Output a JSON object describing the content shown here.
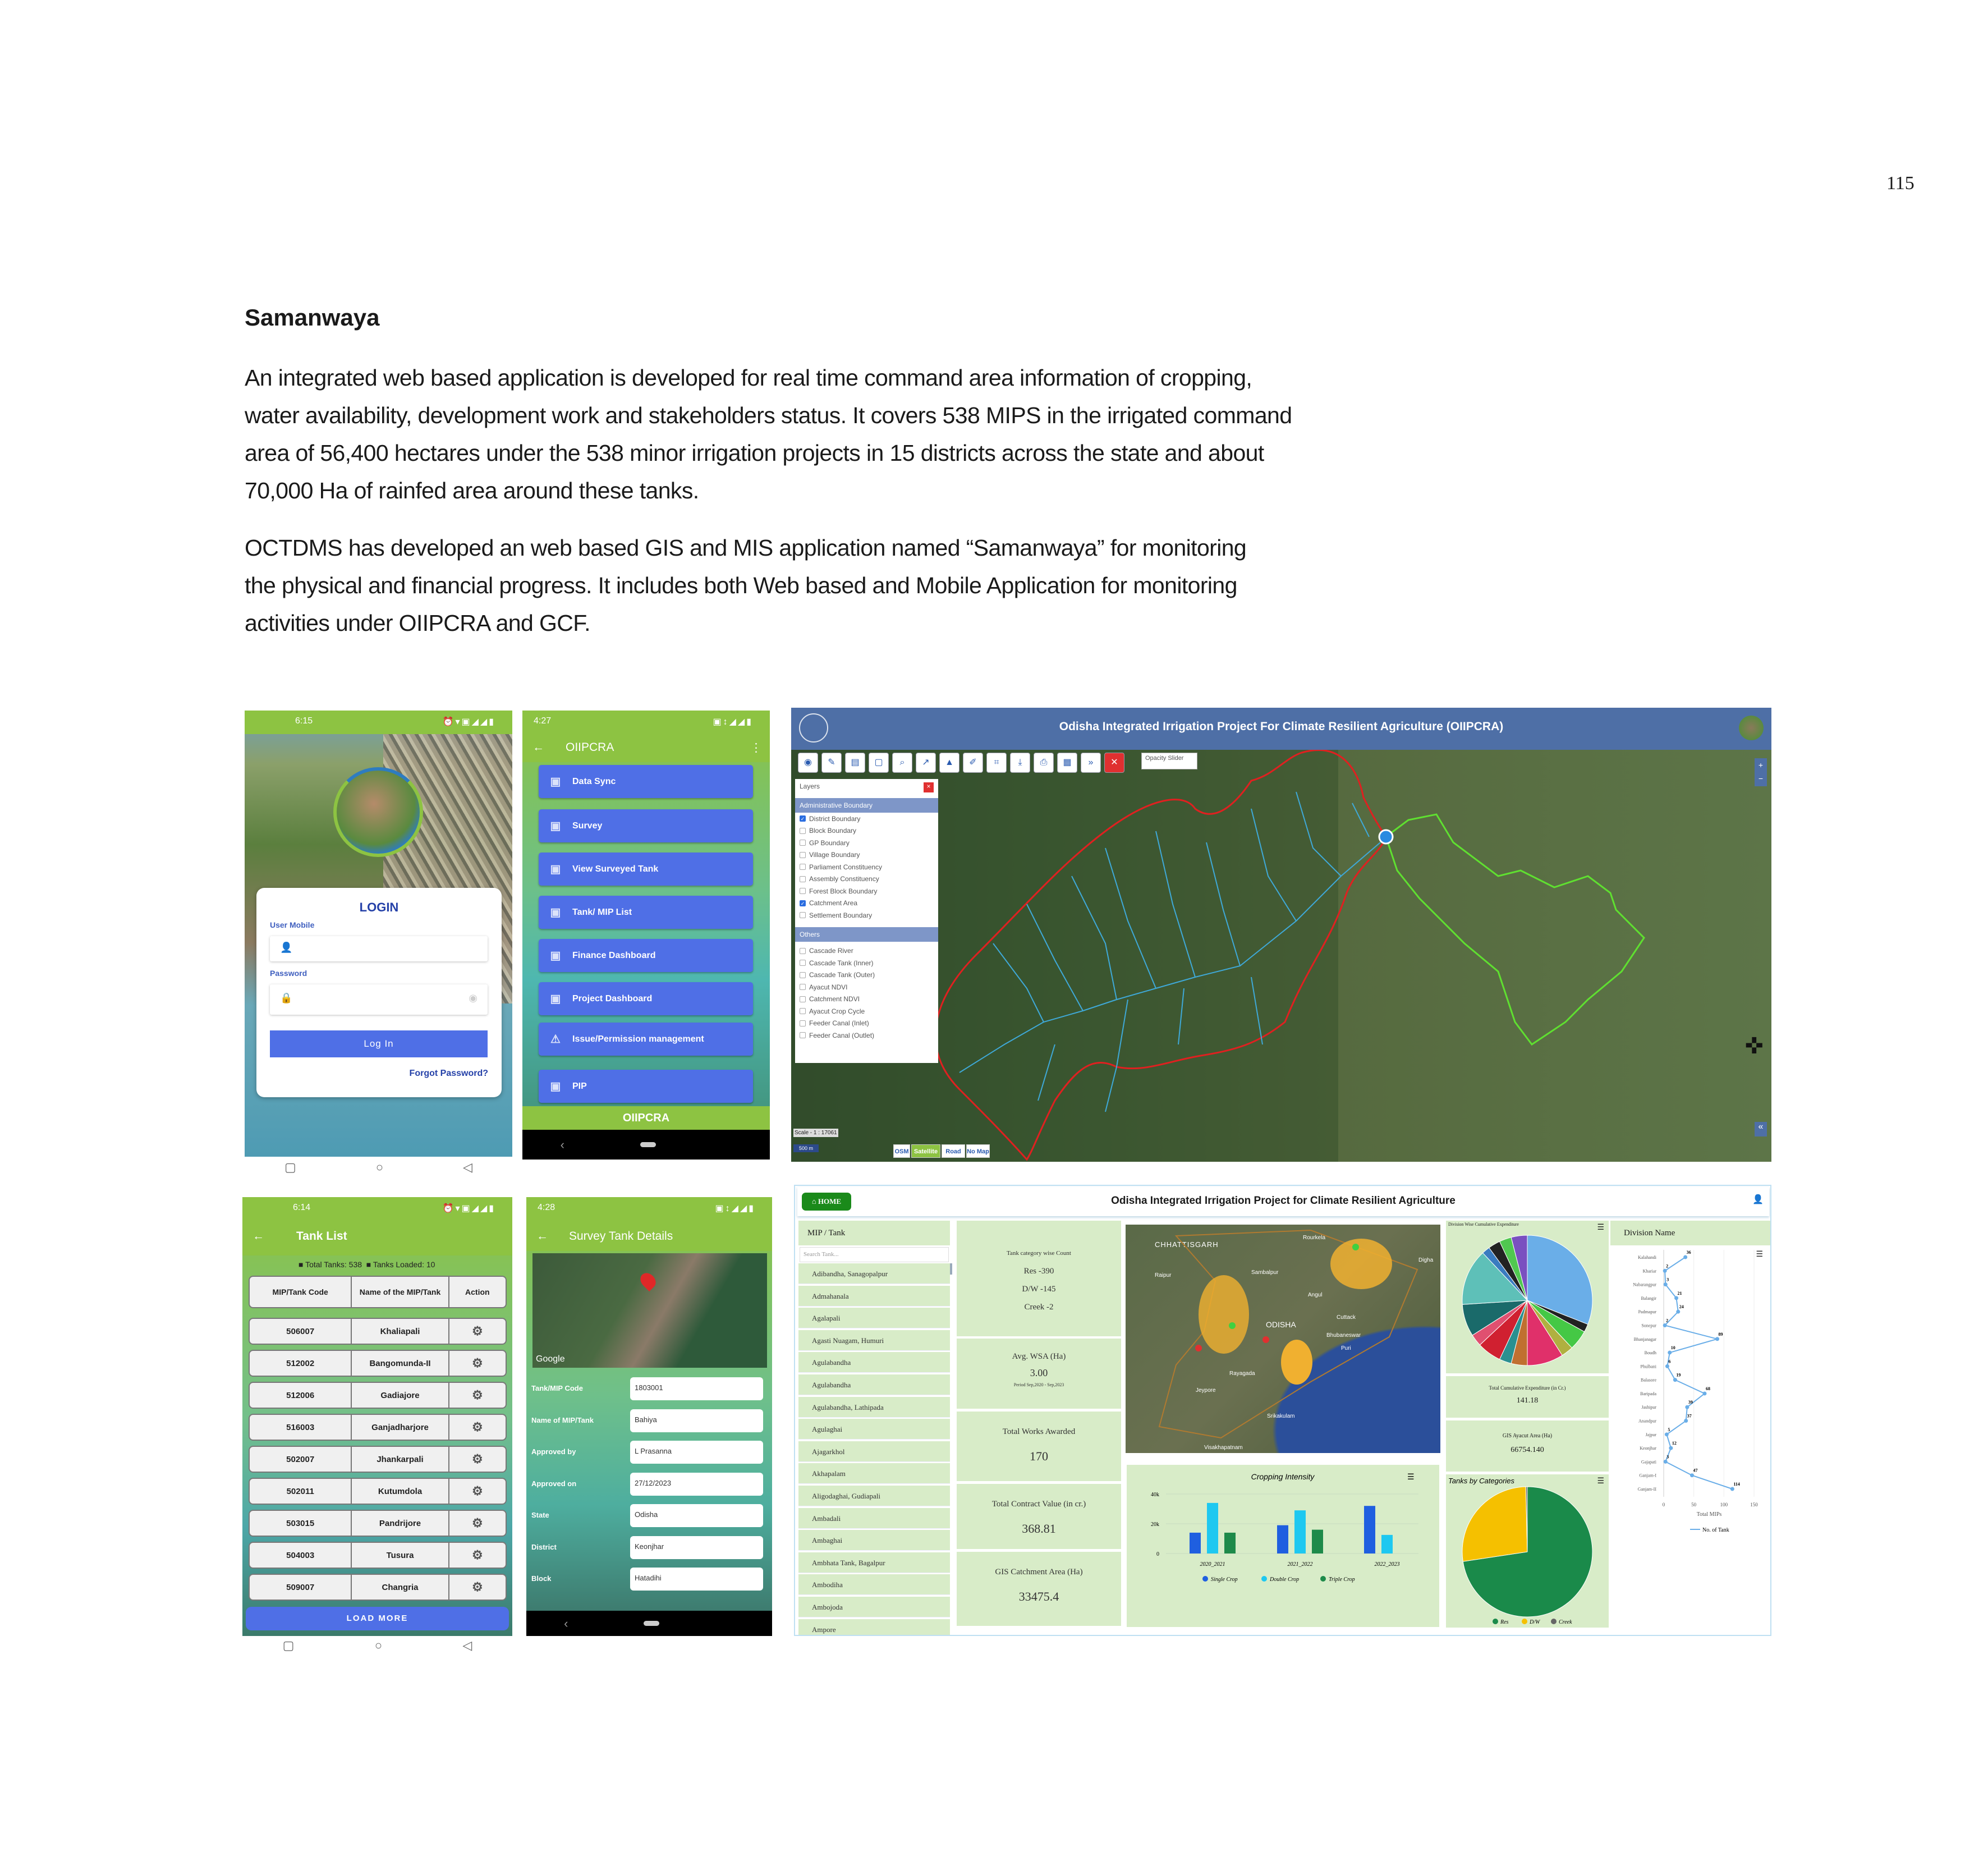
{
  "page": {
    "number": "115",
    "heading": "Samanwaya",
    "para1": [
      "An integrated web based application is developed for real time command area information of cropping,",
      "water availability, development work and stakeholders status. It covers 538 MIPS in the irrigated command",
      "area of 56,400 hectares under the 538 minor irrigation projects in 15 districts across the state and about",
      "70,000 Ha of rainfed area around these tanks."
    ],
    "para2": [
      "OCTDMS has developed an web based GIS and MIS application named “Samanwaya” for monitoring",
      "the physical and financial progress. It includes both Web based and Mobile Application for monitoring",
      "activities under OIIPCRA and GCF."
    ]
  },
  "login_app": {
    "time": "6:15",
    "title": "LOGIN",
    "user_label": "User Mobile",
    "password_label": "Password",
    "login_button": "Log In",
    "forgot_link": "Forgot Password?"
  },
  "menu_app": {
    "time": "4:27",
    "title": "OIIPCRA",
    "footer": "OIIPCRA",
    "items": [
      {
        "label": "Data Sync",
        "icon": "sync-icon"
      },
      {
        "label": "Survey",
        "icon": "survey-icon"
      },
      {
        "label": "View Surveyed Tank",
        "icon": "view-tank-icon"
      },
      {
        "label": "Tank/ MIP List",
        "icon": "list-icon"
      },
      {
        "label": "Finance Dashboard",
        "icon": "finance-icon"
      },
      {
        "label": "Project Dashboard",
        "icon": "project-icon"
      },
      {
        "label": "Issue/Permission management",
        "icon": "warning-icon"
      },
      {
        "label": "PIP",
        "icon": "document-icon"
      }
    ]
  },
  "gis": {
    "title": "Odisha Integrated Irrigation Project For Climate Resilient Agriculture (OIIPCRA)",
    "opacity_label": "Opacity Slider",
    "layers_title": "Layers",
    "admin_header": "Administrative Boundary",
    "admin_layers": [
      {
        "label": "District Boundary",
        "checked": true
      },
      {
        "label": "Block Boundary",
        "checked": false
      },
      {
        "label": "GP Boundary",
        "checked": false
      },
      {
        "label": "Village Boundary",
        "checked": false
      },
      {
        "label": "Parliament Constituency",
        "checked": false
      },
      {
        "label": "Assembly Constituency",
        "checked": false
      },
      {
        "label": "Forest Block Boundary",
        "checked": false
      },
      {
        "label": "Catchment Area",
        "checked": true
      },
      {
        "label": "Settlement Boundary",
        "checked": false
      }
    ],
    "others_header": "Others",
    "other_layers": [
      {
        "label": "Cascade River",
        "checked": false
      },
      {
        "label": "Cascade Tank (Inner)",
        "checked": false
      },
      {
        "label": "Cascade Tank (Outer)",
        "checked": false
      },
      {
        "label": "Ayacut NDVI",
        "checked": false
      },
      {
        "label": "Catchment NDVI",
        "checked": false
      },
      {
        "label": "Ayacut Crop Cycle",
        "checked": false
      },
      {
        "label": "Feeder Canal (Inlet)",
        "checked": false
      },
      {
        "label": "Feeder Canal (Outlet)",
        "checked": false
      }
    ],
    "scale": "Scale - 1 : 17061",
    "scalebar": "500 m",
    "basemaps": [
      "OSM",
      "Satellite",
      "Road",
      "No Map"
    ],
    "active_basemap": "Satellite",
    "colors": {
      "catchment": "#e02020",
      "streams": "#3fa9d8",
      "ayacut": "#5fe030"
    }
  },
  "tank_list": {
    "time": "6:14",
    "title": "Tank List",
    "total": "Total Tanks: 538",
    "loaded": "Tanks Loaded: 10",
    "columns": [
      "MIP/Tank Code",
      "Name of the MIP/Tank",
      "Action"
    ],
    "rows": [
      [
        "506007",
        "Khaliapali"
      ],
      [
        "512002",
        "Bangomunda-II"
      ],
      [
        "512006",
        "Gadiajore"
      ],
      [
        "516003",
        "Ganjadharjore"
      ],
      [
        "502007",
        "Jhankarpali"
      ],
      [
        "502011",
        "Kutumdola"
      ],
      [
        "503015",
        "Pandrijore"
      ],
      [
        "504003",
        "Tusura"
      ],
      [
        "509007",
        "Changria"
      ]
    ],
    "load_more": "LOAD MORE"
  },
  "survey": {
    "time": "4:28",
    "title": "Survey Tank Details",
    "map_brand": "Google",
    "fields": [
      {
        "label": "Tank/MIP Code",
        "value": "1803001"
      },
      {
        "label": "Name of MIP/Tank",
        "value": "Bahiya"
      },
      {
        "label": "Approved by",
        "value": "L Prasanna"
      },
      {
        "label": "Approved on",
        "value": "27/12/2023"
      },
      {
        "label": "State",
        "value": "Odisha"
      },
      {
        "label": "District",
        "value": "Keonjhar"
      },
      {
        "label": "Block",
        "value": "Hatadihi"
      }
    ]
  },
  "dashboard": {
    "home": "HOME",
    "title": "Odisha Integrated Irrigation Project for Climate Resilient Agriculture",
    "mip_header": "MIP / Tank",
    "search_placeholder": "Search Tank...",
    "mips": [
      "Adibandha, Sanagopalpur",
      "Admahanala",
      "Agalapali",
      "Agasti Nuagam, Humuri",
      "Agulabandha",
      "Agulabandha",
      "Agulabandha, Lathipada",
      "Agulaghai",
      "Ajagarkhol",
      "Akhapalam",
      "Aligodaghai, Gudiapali",
      "Ambadali",
      "Ambaghai",
      "Ambhata Tank, Bagalpur",
      "Ambodiha",
      "Ambojoda",
      "Ampore"
    ],
    "tank_count": {
      "label": "Tank category wise Count",
      "res": "Res -390",
      "dw": "D/W -145",
      "creek": "Creek -2"
    },
    "wsa": {
      "label": "Avg. WSA (Ha)",
      "value": "3.00",
      "period": "Period Sep,2020 - Sep,2023"
    },
    "works": {
      "label": "Total Works Awarded",
      "value": "170"
    },
    "contract": {
      "label": "Total Contract Value (in cr.)",
      "value": "368.81"
    },
    "catchment": {
      "label": "GIS Catchment Area (Ha)",
      "value": "33475.4"
    },
    "map_labels": {
      "state1": "CHHATTISGARH",
      "state2": "ODISHA",
      "c1": "Rourkela",
      "c2": "Sambalpur",
      "c3": "Raipur",
      "c4": "Cuttack",
      "c5": "Bhubaneswar",
      "c6": "Puri",
      "c7": "Rayagada",
      "c8": "Jeypore",
      "c9": "Srikakulam",
      "c10": "Visakhapatnam",
      "c11": "Angul",
      "c12": "Digha"
    },
    "expenditure_title": "Division Wise Cumulative Expenditure",
    "total_exp": {
      "label": "Total Cumulative Expenditure (in Cr.)",
      "value": "141.18"
    },
    "ayacut": {
      "label": "GIS Ayacut Area (Ha)",
      "value": "66754.140"
    },
    "division_header": "Division Name"
  },
  "chart_data": [
    {
      "type": "bar",
      "title": "Cropping Intensity",
      "categories": [
        "2020_2021",
        "2021_2022",
        "2022_2023"
      ],
      "series": [
        {
          "name": "Single Crop",
          "values": [
            14000,
            19000,
            32000
          ],
          "color": "#1f5fe0"
        },
        {
          "name": "Double Crop",
          "values": [
            34000,
            29000,
            12500
          ],
          "color": "#1ec8f0"
        },
        {
          "name": "Triple Crop",
          "values": [
            14000,
            16000,
            0
          ],
          "color": "#1e8a4a"
        }
      ],
      "yticks": [
        "0",
        "20k",
        "40k"
      ],
      "ylim": [
        0,
        40000
      ],
      "grid": true,
      "legend": "bottom"
    },
    {
      "type": "pie",
      "title": "Tanks by Categories",
      "categories": [
        "Res",
        "D/W",
        "Creek"
      ],
      "values": [
        390,
        145,
        2
      ],
      "colors": [
        "#1a8a4a",
        "#f5c000",
        "#666666"
      ],
      "legend": "bottom"
    },
    {
      "type": "pie",
      "title": "Division Wise Cumulative Expenditure",
      "values": [
        31,
        2,
        5,
        3,
        9,
        4,
        3,
        6,
        3,
        8,
        14,
        2,
        3,
        3,
        4
      ],
      "colors": [
        "#6aaee8",
        "#222222",
        "#45c845",
        "#b0b040",
        "#e0306a",
        "#c07030",
        "#2a9090",
        "#d02030",
        "#e05070",
        "#1a6a6a",
        "#5ec0b8",
        "#3a7cc0",
        "#222222",
        "#50c850",
        "#7a50c0"
      ],
      "legend": "none"
    },
    {
      "type": "line",
      "title": "Division Name",
      "xlabel": "Total MIPs",
      "xlim": [
        0,
        150
      ],
      "xticks": [
        "0",
        "50",
        "100",
        "150"
      ],
      "categories": [
        "Kalahandi",
        "Khariar",
        "Nabarangpur",
        "Balangir",
        "Padmapur",
        "Sonepur",
        "Bhanjanagar",
        "Boudh",
        "Phulbani",
        "Balasore",
        "Baripada",
        "Jashipur",
        "Anandpur",
        "Jajpur",
        "Keonjhar",
        "Gajapati",
        "Ganjam-I",
        "Ganjam-II"
      ],
      "series": [
        {
          "name": "No. of Tank",
          "values": [
            36,
            2,
            3,
            21,
            24,
            2,
            89,
            10,
            6,
            19,
            68,
            39,
            37,
            5,
            12,
            3,
            47,
            114
          ],
          "color": "#6aaee8"
        }
      ],
      "legend": "bottom"
    }
  ]
}
